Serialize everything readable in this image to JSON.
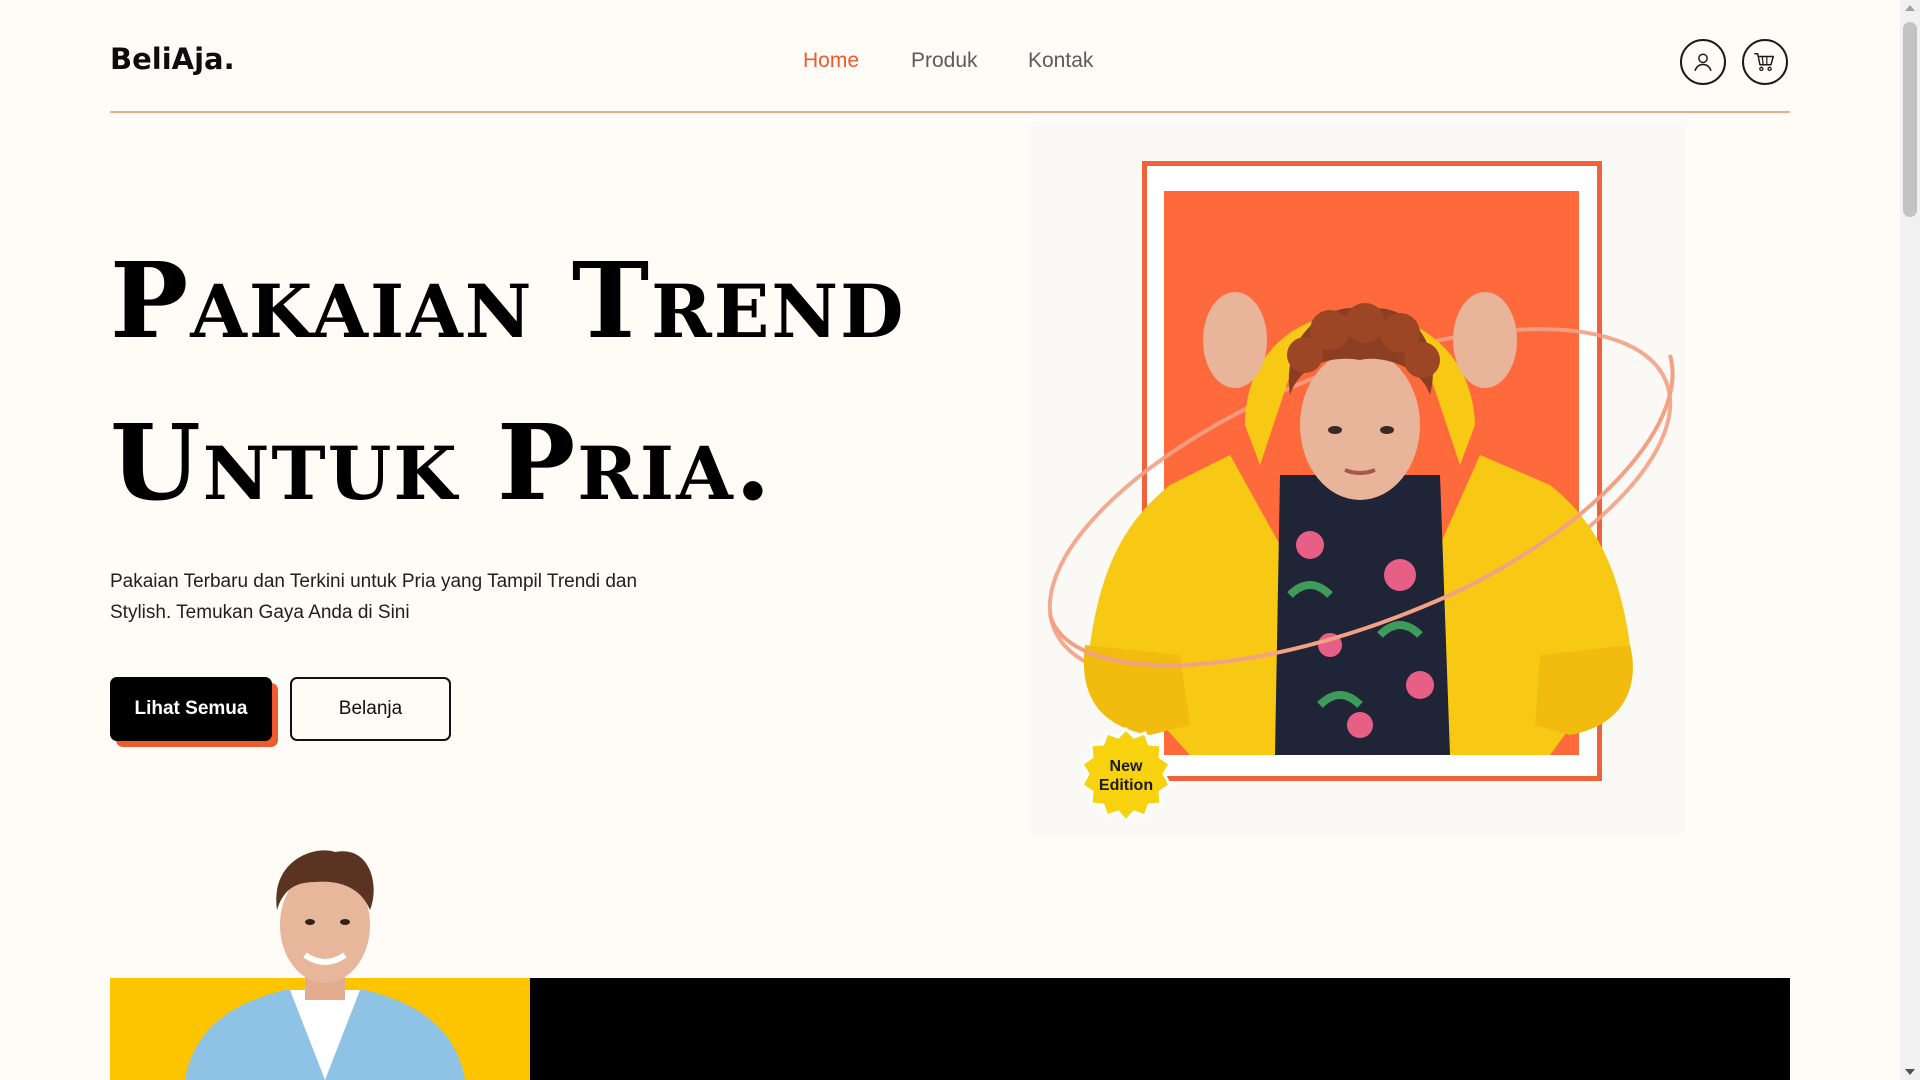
{
  "brand": {
    "logo": "BeliAja."
  },
  "nav": {
    "items": [
      {
        "label": "Home",
        "active": true
      },
      {
        "label": "Produk",
        "active": false
      },
      {
        "label": "Kontak",
        "active": false
      }
    ]
  },
  "header_icons": [
    "user-icon",
    "cart-icon"
  ],
  "hero": {
    "title_line1": "Pakaian Trend",
    "title_line2": "Untuk Pria.",
    "description": "Pakaian Terbaru dan Terkini untuk Pria yang Tampil Trendi dan Stylish. Temukan Gaya Anda di Sini",
    "primary_button": "Lihat Semua",
    "secondary_button": "Belanja",
    "badge": "New Edition"
  },
  "colors": {
    "accent": "#ee5b2f",
    "background": "#fffcf7",
    "yellow": "#fdc500",
    "black": "#000000"
  }
}
